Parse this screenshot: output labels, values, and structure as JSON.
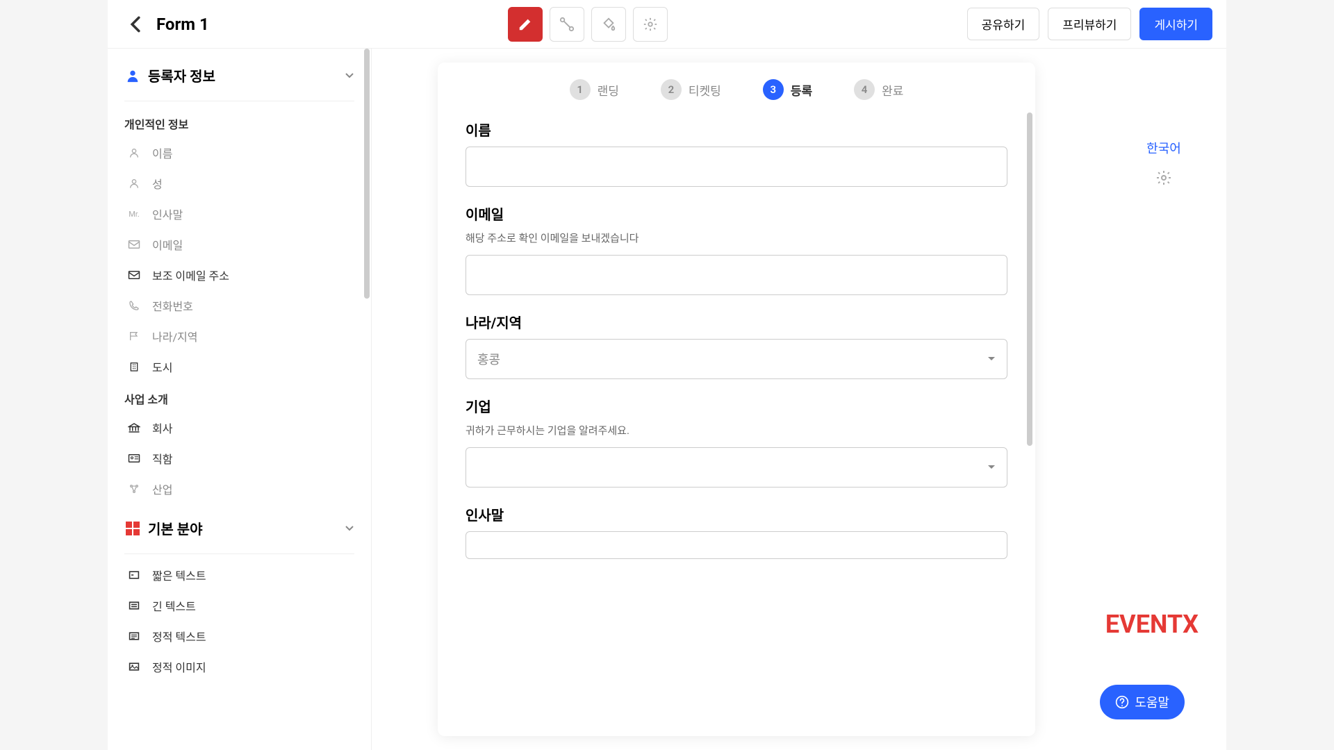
{
  "header": {
    "title": "Form 1",
    "share": "공유하기",
    "preview": "프리뷰하기",
    "publish": "게시하기"
  },
  "sidebar": {
    "section1_title": "등록자 정보",
    "personal_label": "개인적인 정보",
    "business_label": "사업 소개",
    "section2_title": "기본 분야",
    "items": {
      "first_name": "이름",
      "last_name": "성",
      "salutation": "인사말",
      "salutation_prefix": "Mr.",
      "email": "이메일",
      "secondary_email": "보조 이메일 주소",
      "phone": "전화번호",
      "country": "나라/지역",
      "city": "도시",
      "company": "회사",
      "title": "직함",
      "industry": "산업",
      "short_text": "짧은 텍스트",
      "long_text": "긴 텍스트",
      "static_text": "정적 텍스트",
      "static_image": "정적 이미지"
    }
  },
  "stepper": {
    "s1": {
      "num": "1",
      "label": "랜딩"
    },
    "s2": {
      "num": "2",
      "label": "티켓팅"
    },
    "s3": {
      "num": "3",
      "label": "등록"
    },
    "s4": {
      "num": "4",
      "label": "완료"
    }
  },
  "form": {
    "name_label": "이름",
    "email_label": "이메일",
    "email_help": "해당 주소로 확인 이메일을 보내겠습니다",
    "country_label": "나라/지역",
    "country_value": "홍콩",
    "company_label": "기업",
    "company_help": "귀하가 근무하시는 기업을 알려주세요.",
    "salutation_label": "인사말"
  },
  "rail": {
    "language": "한국어"
  },
  "footer": {
    "logo": "EVENTX",
    "help": "도움말"
  }
}
